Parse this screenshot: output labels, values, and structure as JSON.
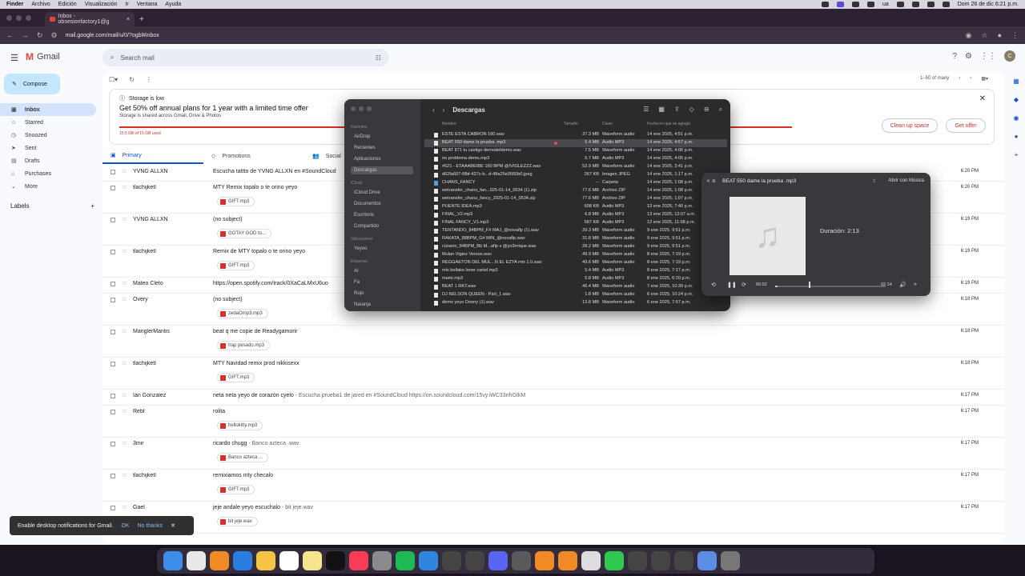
{
  "menubar": {
    "items": [
      "Finder",
      "Archivo",
      "Edición",
      "Visualización",
      "Ir",
      "Ventana",
      "Ayuda"
    ],
    "right_text": "ua",
    "datetime": "Dom 26 de dic 6:21 p.m."
  },
  "browser": {
    "tab_title": "Inbox - obsesionfactory1@g",
    "url": "mail.google.com/mail/u/0/?ogbl#inbox",
    "avatar": "C"
  },
  "gmail": {
    "app_name": "Gmail",
    "search_placeholder": "Search mail",
    "compose": "Compose",
    "nav": [
      {
        "label": "Inbox",
        "icon": "inbox-icon",
        "active": true
      },
      {
        "label": "Starred",
        "icon": "star-icon"
      },
      {
        "label": "Snoozed",
        "icon": "clock-icon"
      },
      {
        "label": "Sent",
        "icon": "send-icon"
      },
      {
        "label": "Drafts",
        "icon": "draft-icon"
      },
      {
        "label": "Purchases",
        "icon": "tag-icon"
      },
      {
        "label": "More",
        "icon": "chevron-down-icon"
      }
    ],
    "labels_heading": "Labels",
    "pagination": "1–50 of many",
    "banner": {
      "flag": "Storage is low",
      "title": "Get 50% off annual plans for 1 year with a limited time offer",
      "subtitle": "Storage is shared across Gmail, Drive & Photos",
      "used": "15.5 GB of 15 GB used",
      "cleanup": "Clean up space",
      "offer": "Get offer"
    },
    "tabs": [
      "Primary",
      "Promotions",
      "Social"
    ],
    "rows": [
      {
        "sender": "YVNG ALLXN",
        "subject": "Escucha tattto de YVNG ALLXN en #SoundCloud",
        "snippet": "",
        "time": "6:20 PM",
        "attachment": ""
      },
      {
        "sender": "tlachijketl",
        "subject": "MTY Remix topalo o te orino yeyo",
        "snippet": "",
        "time": "6:20 PM",
        "attachment": "GIFT.mp3"
      },
      {
        "sender": "YVNG ALLXN",
        "subject": "(no subject)",
        "snippet": "",
        "time": "6:19 PM",
        "attachment": "GOTAY GOD to..."
      },
      {
        "sender": "tlachijketl",
        "subject": "Remix de MTY topalo o te orino yeyo",
        "snippet": "",
        "time": "6:19 PM",
        "attachment": "GIFT.mp3"
      },
      {
        "sender": "Mateo Cleto",
        "subject": "https://open.spotify.com/track/0XaCaLMxU6uo",
        "snippet": "",
        "time": "6:19 PM",
        "attachment": ""
      },
      {
        "sender": "Overy",
        "subject": "(no subject)",
        "snippet": "",
        "time": "6:18 PM",
        "attachment": "zedaOmp3.mp3"
      },
      {
        "sender": "ManglerMantis",
        "subject": "beat q me copie de Readygamorir",
        "snippet": "",
        "time": "6:18 PM",
        "attachment": "trap pesado.mp3"
      },
      {
        "sender": "tlachijketl",
        "subject": "MTY Navidad remix prod nikkisexx",
        "snippet": "",
        "time": "6:18 PM",
        "attachment": "GIFT.mp3"
      },
      {
        "sender": "Ian Gonzalez",
        "subject": "neta neta yeyo de corazón cyelo",
        "snippet": " - Escucha prueba1 de jared en #SoundCloud https://on.soundcloud.com/15vy.iWC33nhGtkM",
        "time": "6:17 PM",
        "attachment": ""
      },
      {
        "sender": "Rebl",
        "subject": "rolita",
        "snippet": "",
        "time": "6:17 PM",
        "attachment": "hellokitty.mp3"
      },
      {
        "sender": "3mir",
        "subject": "ricardo chugg",
        "snippet": " - Banco azteca .wav",
        "time": "6:17 PM",
        "attachment": "Banco azteca ..."
      },
      {
        "sender": "tlachijketl",
        "subject": "remixiamos mty checalo",
        "snippet": "",
        "time": "6:17 PM",
        "attachment": "GIFT.mp3"
      },
      {
        "sender": "Gael",
        "subject": "jeje andale yeyo escuchalo",
        "snippet": " - bit jeje.wav",
        "time": "6:17 PM",
        "attachment": "bit jeje.wav"
      }
    ],
    "notification": {
      "text": "Enable desktop notifications for Gmail.",
      "ok": "OK",
      "no": "No thanks"
    }
  },
  "finder": {
    "title": "Descargas",
    "sidebar": [
      {
        "type": "head",
        "label": "Favoritos"
      },
      {
        "label": "AirDrop"
      },
      {
        "label": "Recientes"
      },
      {
        "label": "Aplicaciones"
      },
      {
        "label": "Descargas",
        "selected": true
      },
      {
        "type": "head",
        "label": "iCloud"
      },
      {
        "label": "iCloud Drive"
      },
      {
        "label": "Documentos"
      },
      {
        "label": "Escritorio"
      },
      {
        "label": "Compartido"
      },
      {
        "type": "head",
        "label": "Ubicaciones"
      },
      {
        "label": "Yeyoo"
      },
      {
        "type": "head",
        "label": "Etiquetas"
      },
      {
        "label": "AI"
      },
      {
        "label": "Fa"
      },
      {
        "label": "Rojo"
      },
      {
        "label": "Naranja"
      }
    ],
    "columns": [
      "Nombre",
      "Tamaño",
      "Clase",
      "Fecha en que se agregó"
    ],
    "files": [
      {
        "name": "ESTE ESTA CABRON 160.wav",
        "size": "37.3 MB",
        "kind": "Waveform audio",
        "date": "14 ene 2025, 4:51 p.m."
      },
      {
        "name": "BEAT 550 dame la prueba .mp3",
        "size": "5.4 MB",
        "kind": "Audio MP3",
        "date": "14 ene 2025, 4:57 p.m.",
        "selected": true
      },
      {
        "name": "BEAT 871 tu castigo demodeldemo.wav",
        "size": "7.5 MB",
        "kind": "Waveform audio",
        "date": "14 ene 2025, 4:06 p.m."
      },
      {
        "name": "no problema demo.mp3",
        "size": "5.7 MB",
        "kind": "Audio MP3",
        "date": "14 ene 2025, 4:05 p.m."
      },
      {
        "name": "#621 - ETAAABEIBE 160 BPM @IVIGLEZZZ.wav",
        "size": "52.9 MB",
        "kind": "Waveform audio",
        "date": "14 ene 2025, 3:41 p.m."
      },
      {
        "name": "d62fa607-6fbf-427c-b...d-48a25e0560b0.jpeg",
        "size": "267 KB",
        "kind": "Imagen JPEG",
        "date": "14 ene 2025, 1:17 p.m."
      },
      {
        "name": "CHANS_FANCY",
        "size": "--",
        "kind": "Carpeta",
        "date": "14 ene 2025, 1:08 p.m.",
        "folder": true
      },
      {
        "name": "wetransfer_chans_fan...025-01-14_0534 (1).zip",
        "size": "77.6 MB",
        "kind": "Archivo ZIP",
        "date": "14 ene 2025, 1:08 p.m."
      },
      {
        "name": "wetransfer_chans_fancy_2025-01-14_0534.zip",
        "size": "77.6 MB",
        "kind": "Archivo ZIP",
        "date": "14 ene 2025, 1:07 p.m."
      },
      {
        "name": "PUENTE IDEA.mp3",
        "size": "608 KB",
        "kind": "Audio MP3",
        "date": "13 ene 2025, 7:40 p.m."
      },
      {
        "name": "FINAL_V2.mp3",
        "size": "6.8 MB",
        "kind": "Audio MP3",
        "date": "13 ene 2025, 12:07 a.m."
      },
      {
        "name": "FINAL FANCY_V1.mp3",
        "size": "587 KB",
        "kind": "Audio MP3",
        "date": "12 ene 2025, 11:58 p.m."
      },
      {
        "name": "TENTANDO_84BPM_F# MAJ_@novaflp (1).wav",
        "size": "39.3 MB",
        "kind": "Waveform audio",
        "date": "9 ene 2025, 9:51 p.m."
      },
      {
        "name": "RAKATA_88BPM_G# MIN_@novaflp.wav",
        "size": "31.8 MB",
        "kind": "Waveform audio",
        "date": "9 ene 2025, 9:51 p.m."
      },
      {
        "name": "cúramo_84BPM_Bb M...aflp x @yo3nrique.wav",
        "size": "28.2 MB",
        "kind": "Waveform audio",
        "date": "9 ene 2025, 9:51 p.m."
      },
      {
        "name": "Mulan Vigiez Versos.wav",
        "size": "49.9 MB",
        "kind": "Waveform audio",
        "date": "8 ene 2025, 7:19 p.m."
      },
      {
        "name": "REGGAETON DEL MUL...N EL EZYA mix 1.0.wav",
        "size": "49.6 MB",
        "kind": "Waveform audio",
        "date": "8 ene 2025, 7:19 p.m."
      },
      {
        "name": "mix bellako loner cartel.mp3",
        "size": "5.4 MB",
        "kind": "Audio MP3",
        "date": "8 ene 2025, 7:17 p.m."
      },
      {
        "name": "mami.mp3",
        "size": "5.8 MB",
        "kind": "Audio MP3",
        "date": "8 ene 2025, 6:10 p.m."
      },
      {
        "name": "BEAT 1 RKT.wav",
        "size": "46.4 MB",
        "kind": "Waveform audio",
        "date": "7 ene 2025, 10:39 p.m."
      },
      {
        "name": "DJ NELSON QUEEN - Part_1.wav",
        "size": "1.8 MB",
        "kind": "Waveform audio",
        "date": "6 ene 2025, 10:24 p.m."
      },
      {
        "name": "demo yeyo Doony (1).wav",
        "size": "13.8 MB",
        "kind": "Waveform audio",
        "date": "6 ene 2025, 7:57 p.m."
      }
    ]
  },
  "player": {
    "title": "BEAT 550 dame la prueba .mp3",
    "open_with": "Abrir con Música",
    "duration_label": "Duración: 2:13",
    "current": "00:02",
    "total": "02:14",
    "progress": 0.02
  },
  "dock": [
    "finder-icon",
    "chrome-icon",
    "fl-studio-icon",
    "app-store-icon",
    "photos-icon",
    "calendar-icon",
    "notes-icon",
    "tv-icon",
    "music-icon",
    "settings-icon",
    "spotify-icon",
    "safari-icon",
    "app-icon",
    "app-icon",
    "discord-icon",
    "app-icon",
    "fl-studio-icon",
    "fl-studio-icon",
    "app-icon",
    "facetime-icon",
    "app-icon",
    "app-icon",
    "app-icon",
    "downloads-icon",
    "trash-icon"
  ]
}
